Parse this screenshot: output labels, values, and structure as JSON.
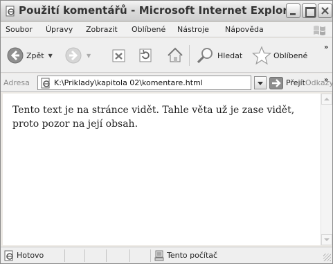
{
  "window": {
    "title": "Použití komentářů - Microsoft Internet Explorer",
    "controls": [
      "minimize",
      "maximize",
      "close"
    ]
  },
  "menubar": {
    "items": [
      "Soubor",
      "Úpravy",
      "Zobrazit",
      "Oblíbené",
      "Nástroje",
      "Nápověda"
    ]
  },
  "toolbar": {
    "back_label": "Zpět",
    "search_label": "Hledat",
    "favorites_label": "Oblíbené",
    "more": "»"
  },
  "addressbar": {
    "label": "Adresa",
    "url": "K:\\Priklady\\kapitola 02\\komentare.html",
    "go_label": "Přejít",
    "links_label": "Odkazy",
    "more": "»"
  },
  "content": {
    "text": "Tento text je na stránce vidět. Tahle věta už je zase vidět, proto pozor na její obsah."
  },
  "statusbar": {
    "status": "Hotovo",
    "zone": "Tento počítač"
  },
  "icons": {
    "page": "ie-page-icon",
    "back": "back-arrow-icon",
    "forward": "forward-arrow-icon",
    "stop": "stop-icon",
    "refresh": "refresh-icon",
    "home": "home-icon",
    "search": "search-icon",
    "favorites": "star-icon",
    "go": "go-arrow-icon",
    "zone": "computer-icon"
  }
}
